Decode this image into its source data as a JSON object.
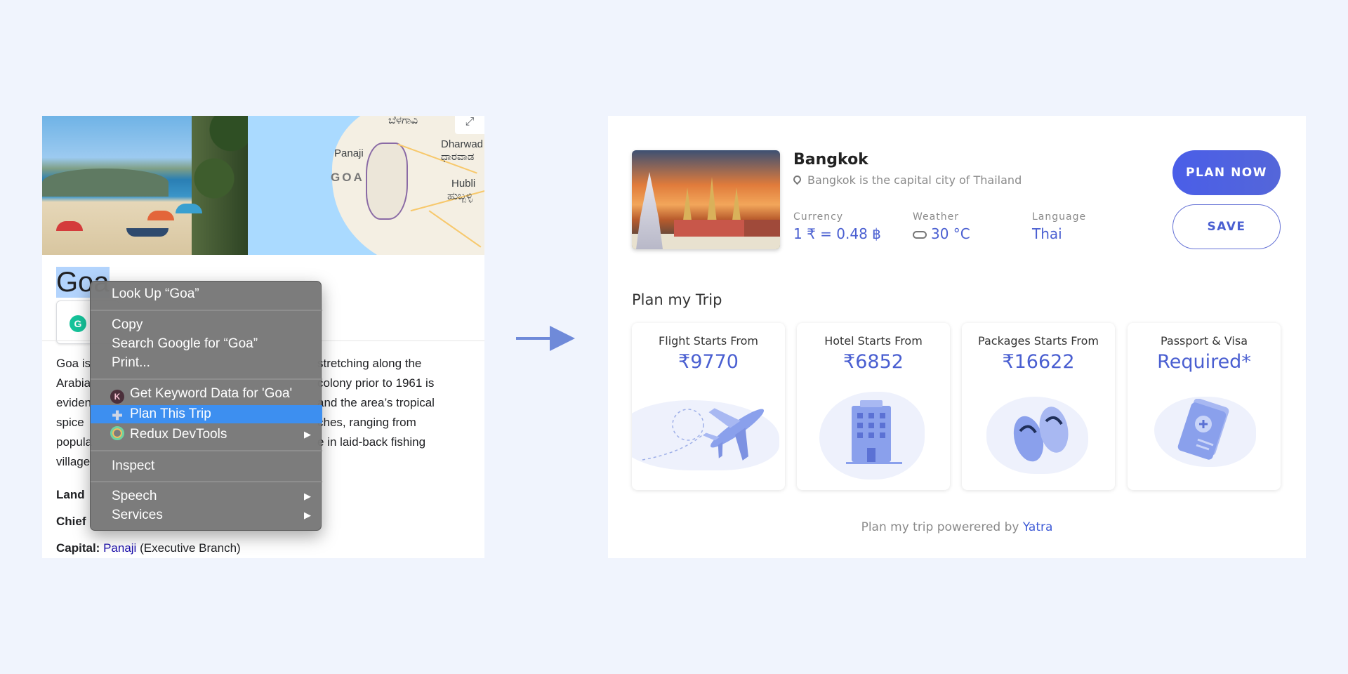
{
  "left_panel": {
    "map_labels": {
      "top": "ಬೆಳಗಾವಿ",
      "dharwad": "Dharwad",
      "dharwad_kn": "ಧಾರವಾಡ",
      "panaji": "Panaji",
      "goa": "GOA",
      "hubli": "Hubli",
      "hubli_kn": "ಹುಬ್ಬಳ್ಳಿ"
    },
    "map_expand": "⤢",
    "title": "Goa",
    "description_lines": [
      "Goa is",
      "Arabia",
      "eviden",
      "spice",
      "popula",
      "village"
    ],
    "description_right": [
      "stretching along the",
      "colony prior to 1961 is",
      "and the area’s tropical",
      "ches, ranging from",
      "e in laid-back fishing",
      ""
    ],
    "facts": [
      {
        "label": "Land",
        "value": ""
      },
      {
        "label": "Chief",
        "value": ""
      }
    ],
    "capital": {
      "label": "Capital:",
      "link": "Panaji",
      "rest": "(Executive Branch)"
    },
    "grammarly_icon": "G"
  },
  "context_menu": {
    "items": {
      "lookup": "Look Up “Goa”",
      "copy": "Copy",
      "search": "Search Google for “Goa”",
      "print": "Print...",
      "keyword": "Get Keyword Data for 'Goa'",
      "plan": "Plan This Trip",
      "redux": "Redux DevTools",
      "inspect": "Inspect",
      "speech": "Speech",
      "services": "Services"
    },
    "keyword_icon": "K",
    "submenu_arrow": "▶",
    "highlight_color": "#3d8ff0"
  },
  "right_panel": {
    "city": "Bangkok",
    "city_description": "Bangkok is the capital city of Thailand",
    "info": {
      "currency_label": "Currency",
      "currency_value": "1 ₹ = 0.48 ฿",
      "weather_label": "Weather",
      "weather_value": "30 °C",
      "language_label": "Language",
      "language_value": "Thai"
    },
    "buttons": {
      "plan": "PLAN NOW",
      "save": "SAVE"
    },
    "section_title": "Plan my Trip",
    "cards": [
      {
        "label": "Flight Starts From",
        "value": "₹9770",
        "icon": "airplane-icon"
      },
      {
        "label": "Hotel Starts From",
        "value": "₹6852",
        "icon": "hotel-icon"
      },
      {
        "label": "Packages Starts From",
        "value": "₹16622",
        "icon": "flip-flops-icon"
      },
      {
        "label": "Passport & Visa",
        "value": "Required*",
        "icon": "passport-icon"
      }
    ],
    "powered_text": "Plan my trip powerered by",
    "powered_link": "Yatra",
    "accent_color": "#4a5fd1"
  }
}
